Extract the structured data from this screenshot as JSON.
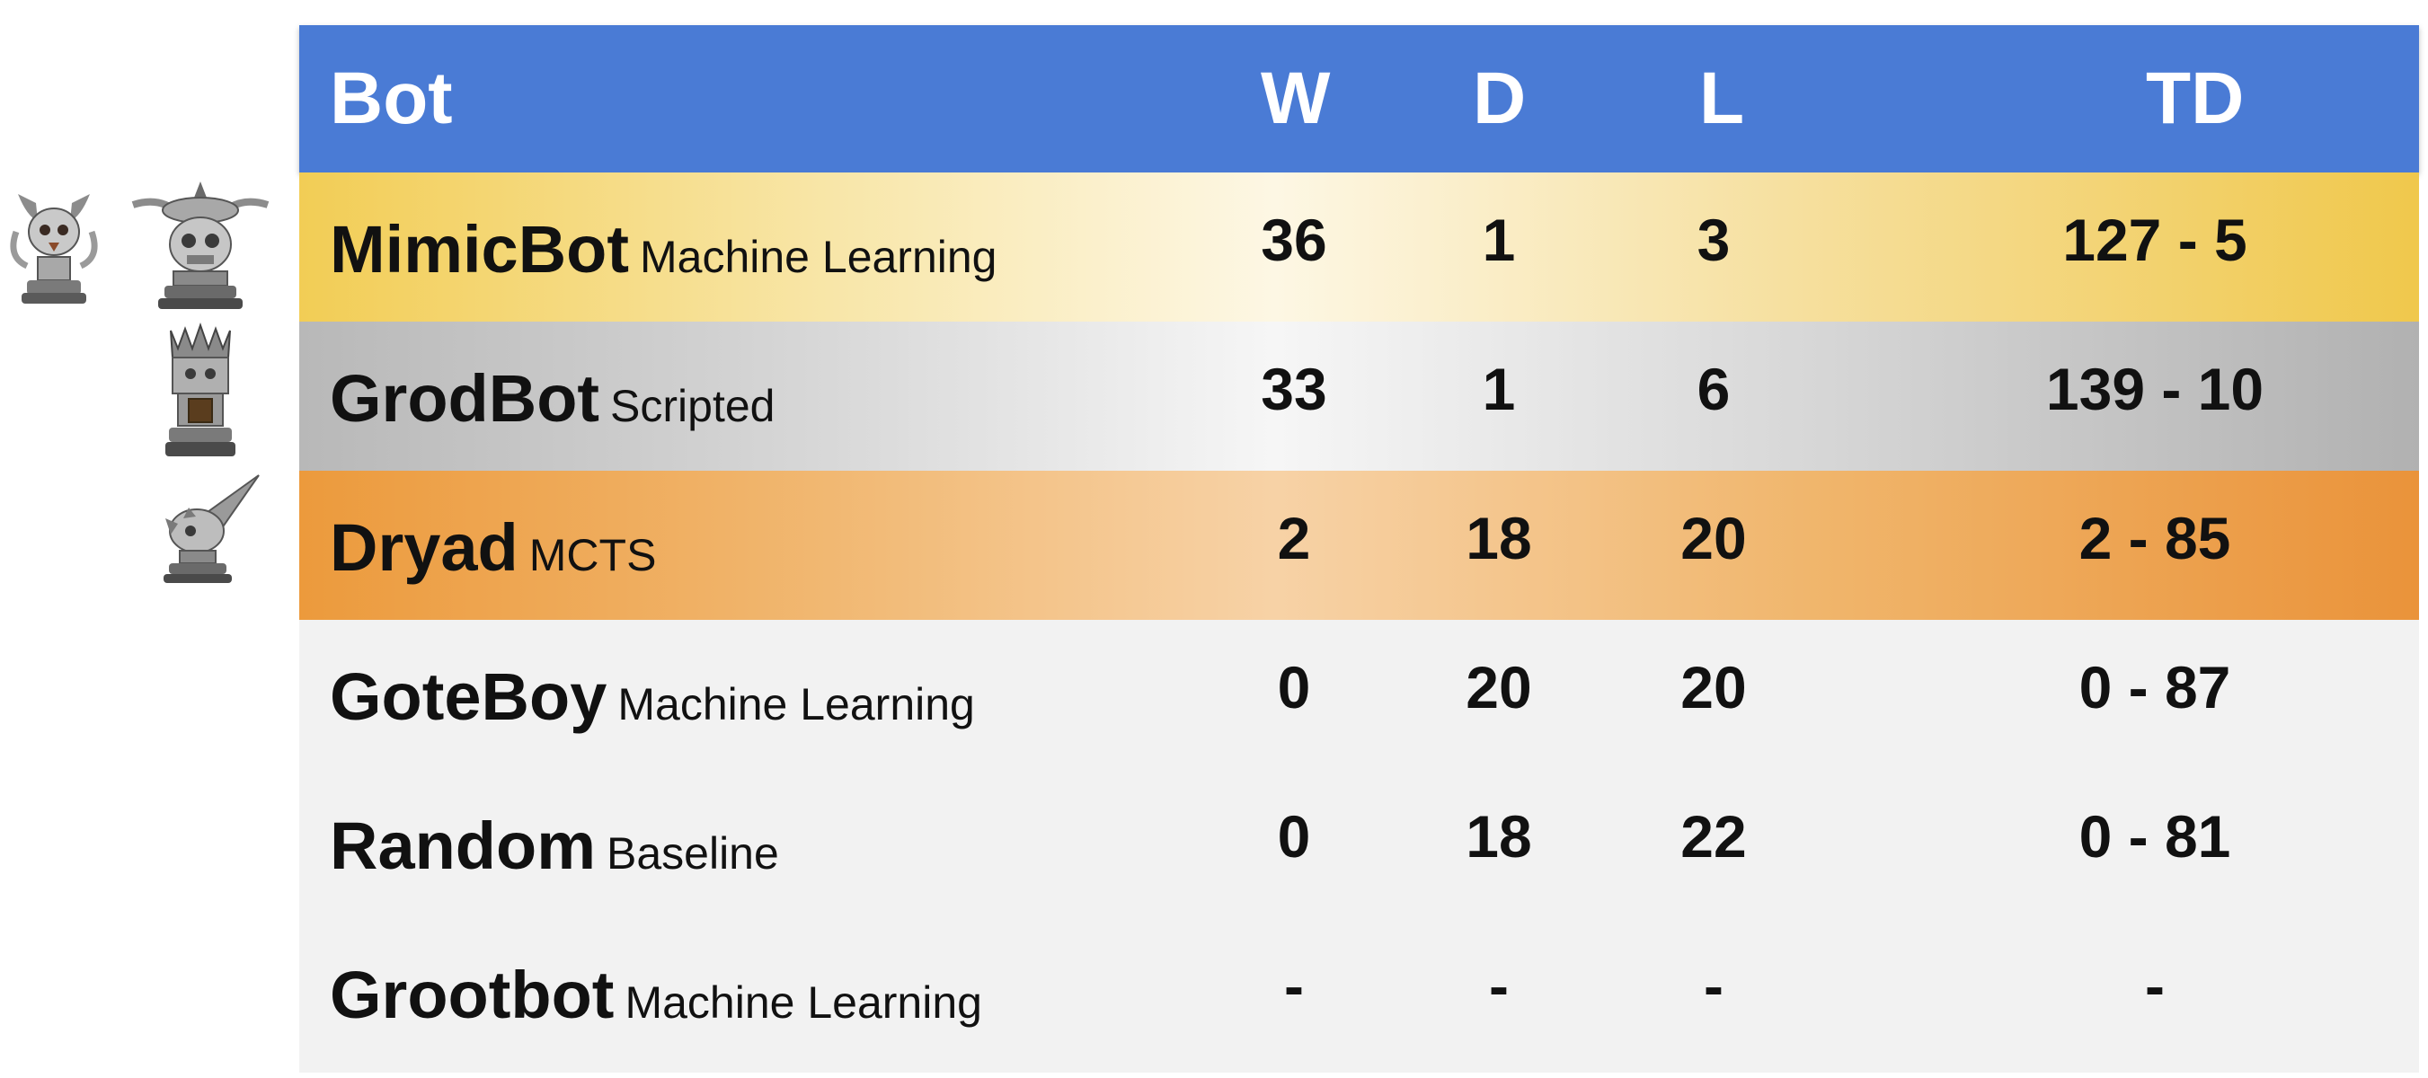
{
  "header": {
    "bot": "Bot",
    "w": "W",
    "d": "D",
    "l": "L",
    "td": "TD"
  },
  "rows": [
    {
      "name": "MimicBot",
      "type": "Machine Learning",
      "w": "36",
      "d": "1",
      "l": "3",
      "td": "127 - 5"
    },
    {
      "name": "GrodBot",
      "type": "Scripted",
      "w": "33",
      "d": "1",
      "l": "6",
      "td": "139 - 10"
    },
    {
      "name": "Dryad",
      "type": "MCTS",
      "w": "2",
      "d": "18",
      "l": "20",
      "td": "2 - 85"
    },
    {
      "name": "GoteBoy",
      "type": "Machine Learning",
      "w": "0",
      "d": "20",
      "l": "20",
      "td": "0 - 87"
    },
    {
      "name": "Random",
      "type": "Baseline",
      "w": "0",
      "d": "18",
      "l": "22",
      "td": "0 - 81"
    },
    {
      "name": "Grootbot",
      "type": "Machine Learning",
      "w": "-",
      "d": "-",
      "l": "-",
      "td": "-"
    }
  ],
  "colors": {
    "header": "#4a7bd5",
    "gold": "#f0c84c",
    "silver": "#b8b8b8",
    "bronze": "#ea933a",
    "plain": "#f2f2f2"
  },
  "trophies": [
    "skull-trophy-icon",
    "chaos-trophy-icon",
    "tower-trophy-icon",
    "spiked-trophy-icon"
  ]
}
